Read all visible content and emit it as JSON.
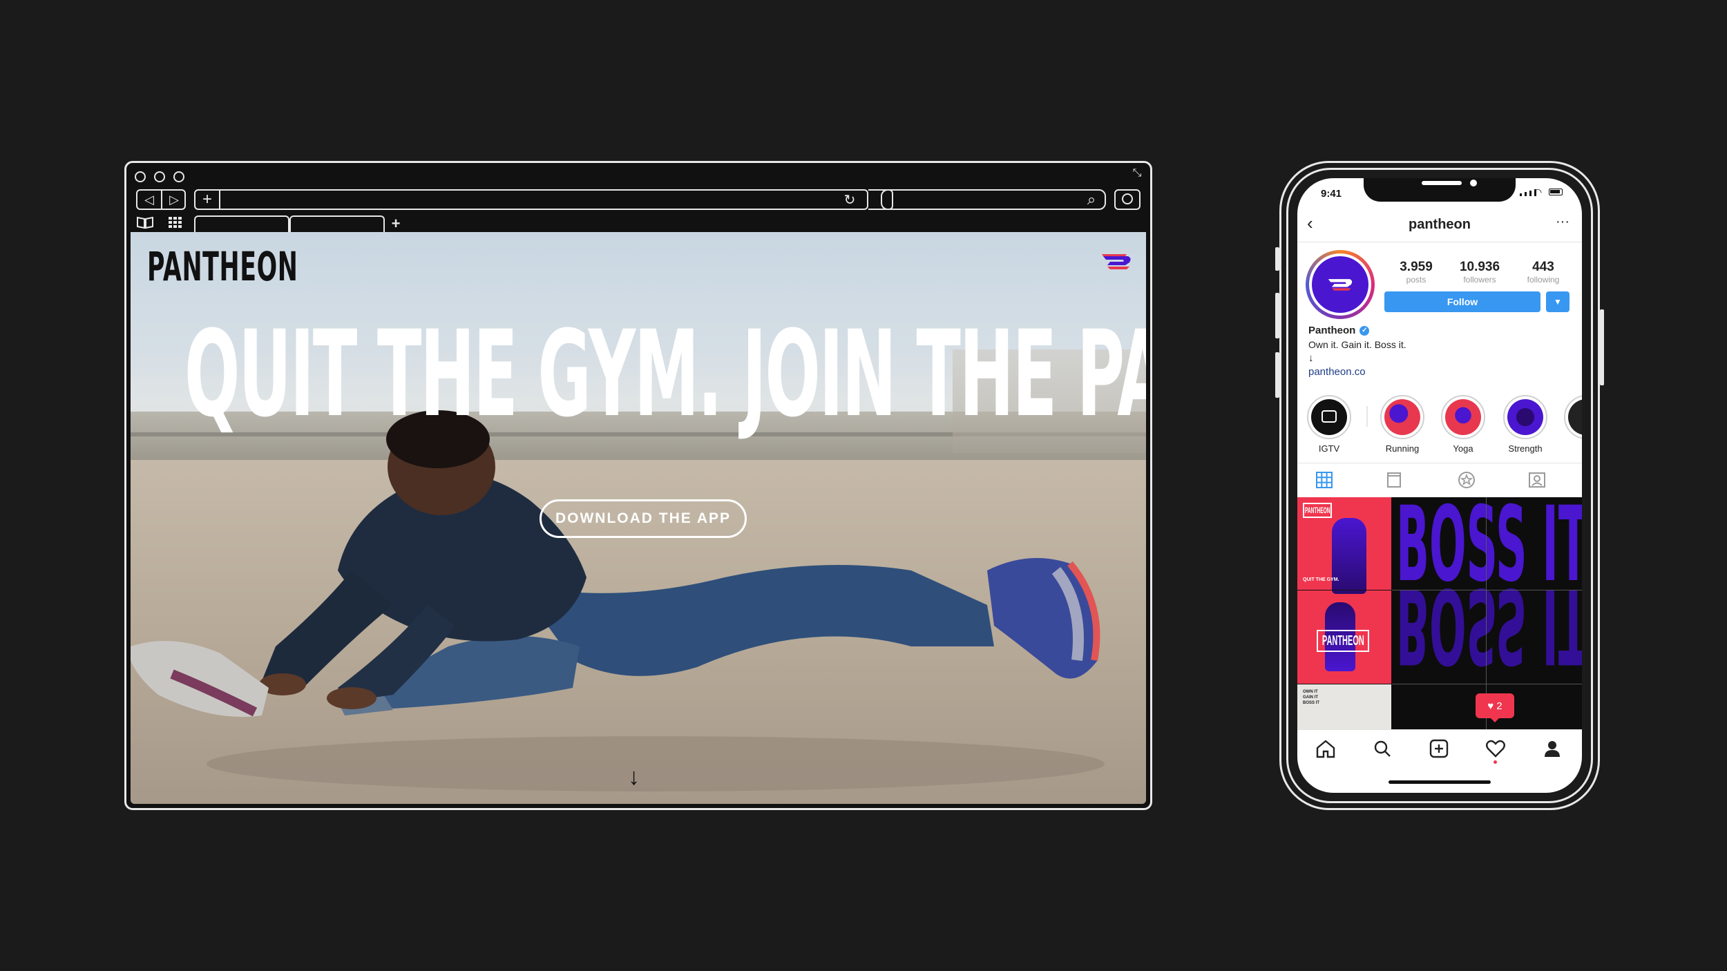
{
  "browser": {
    "nav_back": "◁",
    "nav_forward": "▷",
    "new_tab": "+",
    "reload": "↻",
    "search_icon": "⌕",
    "bookmarks_icon": "book-icon",
    "grid_icon": "grid-icon",
    "add_tab": "+"
  },
  "website": {
    "logo": "PANTHEON",
    "headline": "QUIT THE GYM. JOIN THE PANTHEON.",
    "cta": "DOWNLOAD THE APP",
    "scroll_arrow": "↓",
    "brand_colors": {
      "red": "#e8384f",
      "purple": "#4a16d0"
    }
  },
  "phone": {
    "status_time": "9:41",
    "profile": {
      "username": "pantheon",
      "posts_count": "3.959",
      "posts_label": "posts",
      "followers_count": "10.936",
      "followers_label": "followers",
      "following_count": "443",
      "following_label": "following",
      "follow_button": "Follow",
      "name": "Pantheon",
      "bio": "Own it. Gain it. Boss it.",
      "bio_arrow": "↓",
      "link": "pantheon.co"
    },
    "highlights": [
      {
        "label": "IGTV"
      },
      {
        "label": "Running"
      },
      {
        "label": "Yoga"
      },
      {
        "label": "Strength"
      }
    ],
    "grid": {
      "poster_logo": "PANTHEON",
      "poster_sub": "QUIT THE GYM.",
      "poster_logo2": "PANTHEON",
      "boss_text": "BOSS IT",
      "boss_text2": "BOSS IT",
      "caption_lines": "OWN IT\nGAIN IT\nBOSS IT"
    },
    "notification_count": "2",
    "follow_color": "#3897f0"
  }
}
